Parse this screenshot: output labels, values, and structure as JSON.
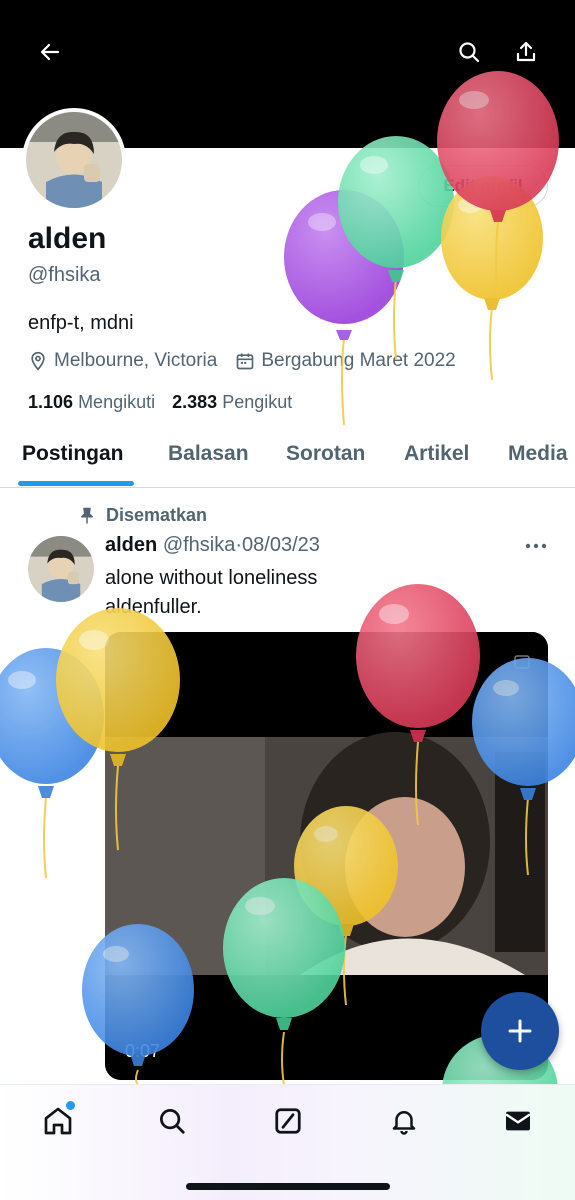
{
  "header": {
    "back_icon": "arrow-left-icon",
    "search_icon": "search-icon",
    "share_icon": "share-icon"
  },
  "profile": {
    "edit_label": "Edit profil",
    "name": "alden",
    "handle": "@fhsika",
    "bio": "enfp-t, mdni",
    "location": "Melbourne, Victoria",
    "joined": "Bergabung Maret 2022",
    "following_count": "1.106",
    "following_label": "Mengikuti",
    "followers_count": "2.383",
    "followers_label": "Pengikut"
  },
  "tabs": [
    {
      "label": "Postingan",
      "active": true
    },
    {
      "label": "Balasan",
      "active": false
    },
    {
      "label": "Sorotan",
      "active": false
    },
    {
      "label": "Artikel",
      "active": false
    },
    {
      "label": "Media",
      "active": false
    }
  ],
  "post": {
    "pinned_label": "Disematkan",
    "author_name": "alden",
    "author_handle": "@fhsika",
    "separator": "·",
    "date": "08/03/23",
    "text_line1": "alone without loneliness",
    "text_line2": "aldenfuller.",
    "video_time": "0:07"
  },
  "colors": {
    "accent": "#1d9bf0",
    "fab": "#1d4f9e",
    "balloon_red": "#e0445f",
    "balloon_green": "#6fe0b2",
    "balloon_yellow": "#f2cd3a",
    "balloon_purple": "#a24ee0",
    "balloon_blue": "#4b95ec"
  },
  "bottom_nav": [
    "home-icon",
    "search-icon",
    "grok-icon",
    "bell-icon",
    "mail-icon"
  ]
}
